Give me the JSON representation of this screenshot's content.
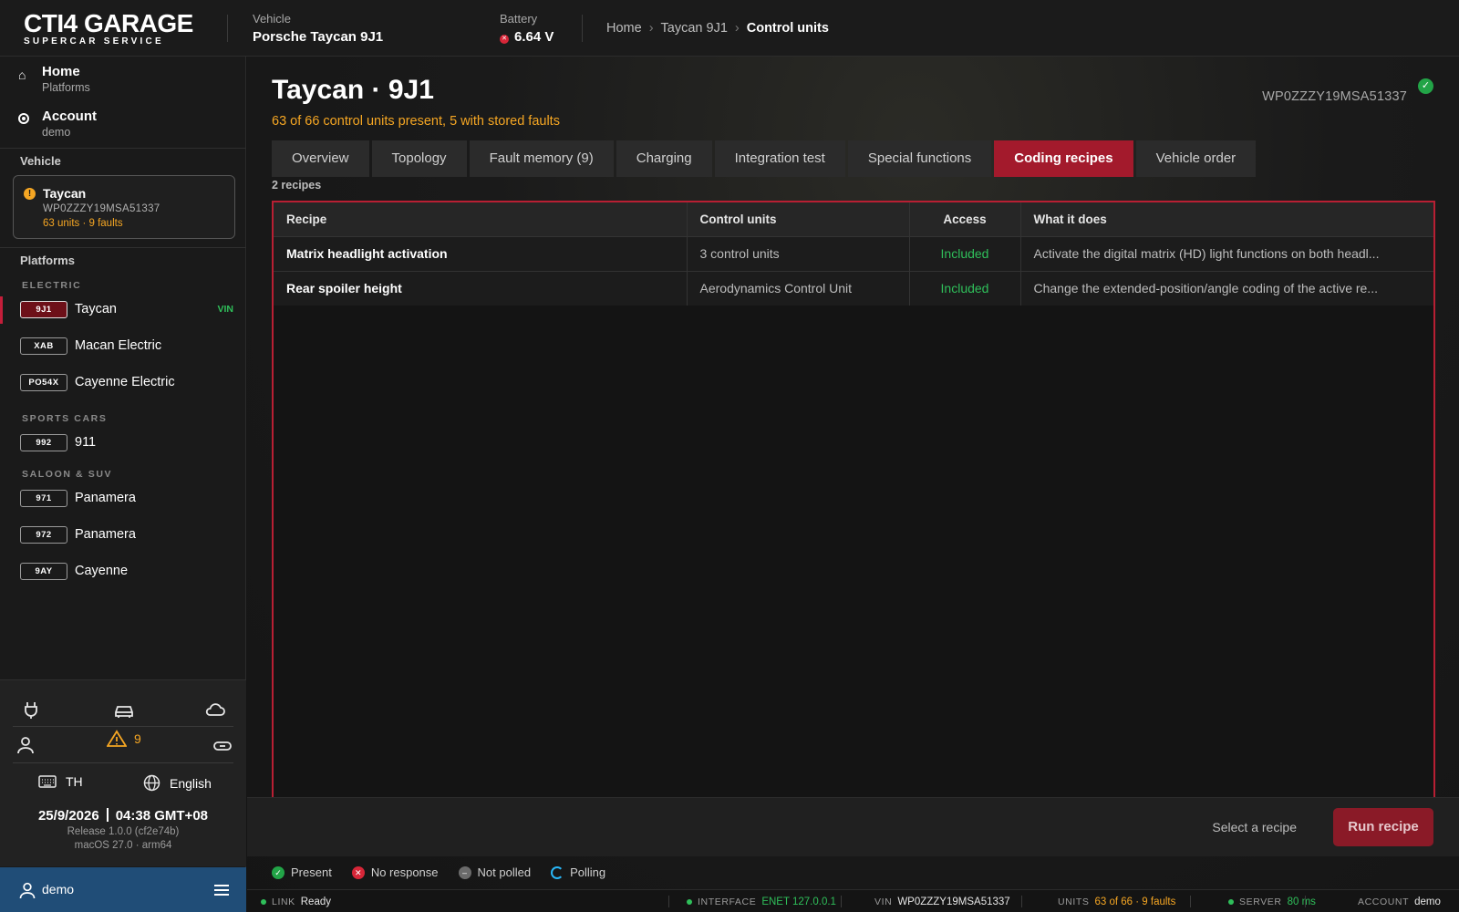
{
  "app": {
    "logo_main": "CTI4 GARAGE",
    "logo_sub": "SUPERCAR SERVICE"
  },
  "header": {
    "vehicle_label": "Vehicle",
    "vehicle_value": "Porsche Taycan 9J1",
    "battery_label": "Battery",
    "battery_value": "6.64 V",
    "battery_status_color": "#d72638",
    "breadcrumb": [
      "Home",
      "Taycan 9J1",
      "Control units"
    ]
  },
  "sidebar": {
    "nav": [
      {
        "label": "Home",
        "sub": "Platforms",
        "icon": "home-icon"
      },
      {
        "label": "Account",
        "sub": "demo",
        "icon": "radio-icon"
      }
    ],
    "vehicle_heading": "Vehicle",
    "vehicle_card": {
      "name": "Taycan",
      "vin": "WP0ZZZY19MSA51337",
      "meta": "63 units · 9 faults",
      "warn_icon": "!"
    },
    "platforms_heading": "Platforms",
    "groups": [
      {
        "label": "ELECTRIC",
        "items": [
          {
            "code": "9J1",
            "name": "Taycan",
            "tag": "VIN",
            "active": true
          },
          {
            "code": "XAB",
            "name": "Macan Electric",
            "tag": "",
            "active": false
          },
          {
            "code": "PO54X",
            "name": "Cayenne Electric",
            "tag": "",
            "active": false
          }
        ]
      },
      {
        "label": "SPORTS CARS",
        "items": [
          {
            "code": "992",
            "name": "911",
            "tag": "",
            "active": false
          }
        ]
      },
      {
        "label": "SALOON & SUV",
        "items": [
          {
            "code": "971",
            "name": "Panamera",
            "tag": "",
            "active": false
          },
          {
            "code": "972",
            "name": "Panamera",
            "tag": "",
            "active": false
          },
          {
            "code": "9AY",
            "name": "Cayenne",
            "tag": "",
            "active": false
          }
        ]
      }
    ],
    "bottom": {
      "warning_count": "9",
      "keyboard_layout": "TH",
      "language": "English",
      "date": "25/9/2026",
      "time": "04:38 GMT+08",
      "release": "Release 1.0.0 (cf2e74b)",
      "os": "macOS 27.0 · arm64"
    },
    "user": "demo"
  },
  "main": {
    "title": "Taycan · 9J1",
    "subtitle": "63 of 66 control units present, 5 with stored faults",
    "vin": "WP0ZZZY19MSA51337",
    "tabs": [
      {
        "label": "Overview",
        "active": false
      },
      {
        "label": "Topology",
        "active": false
      },
      {
        "label": "Fault memory (9)",
        "active": false
      },
      {
        "label": "Charging",
        "active": false
      },
      {
        "label": "Integration test",
        "active": false
      },
      {
        "label": "Special functions",
        "active": false
      },
      {
        "label": "Coding recipes",
        "active": true
      },
      {
        "label": "Vehicle order",
        "active": false
      }
    ],
    "count_label": "2 recipes",
    "table": {
      "columns": [
        "Recipe",
        "Control units",
        "Access",
        "What it does"
      ],
      "rows": [
        [
          "Matrix headlight activation",
          "3 control units",
          "Included",
          "Activate the digital matrix (HD) light functions on both headl..."
        ],
        [
          "Rear spoiler height",
          "Aerodynamics Control Unit",
          "Included",
          "Change the extended-position/angle coding of the active re..."
        ]
      ]
    },
    "action_hint": "Select a recipe",
    "run_button": "Run recipe"
  },
  "legend": [
    {
      "label": "Present",
      "color": "#22a447",
      "icon": "check-icon"
    },
    {
      "label": "No response",
      "color": "#d72638",
      "icon": "x-icon"
    },
    {
      "label": "Not polled",
      "color": "#6b6b6b",
      "icon": "minus-icon"
    },
    {
      "label": "Polling",
      "color": "#29b6f6",
      "icon": "spinner-icon"
    }
  ],
  "status_bar": {
    "link_key": "LINK",
    "link_val": "Ready",
    "interface_key": "INTERFACE",
    "interface_val": "ENET 127.0.0.1",
    "vin_key": "VIN",
    "vin_val": "WP0ZZZY19MSA51337",
    "units_key": "UNITS",
    "units_val": "63 of 66 · 9 faults",
    "server_key": "SERVER",
    "server_val": "80 ms",
    "account_key": "ACCOUNT",
    "account_val": "demo"
  }
}
